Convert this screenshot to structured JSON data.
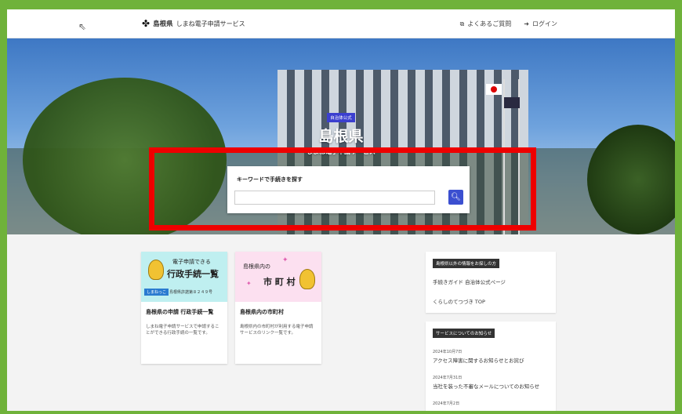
{
  "header": {
    "logo_prefix": "島根県",
    "logo_suffix": "しまね電子申請サービス",
    "faq_label": "よくあるご質問",
    "login_label": "ログイン"
  },
  "hero": {
    "badge": "自治体公式",
    "title": "島根県",
    "subtitle": "しまね電子申請サービス"
  },
  "search": {
    "label": "キーワードで手続きを探す",
    "value": "",
    "placeholder": ""
  },
  "cards": [
    {
      "image_line1": "電子申請できる",
      "image_line2": "行政手続一覧",
      "image_badge": "しまねっこ",
      "image_note": "島根県許諾第８２４９号",
      "title": "島根県の申請 行政手続一覧",
      "desc": "しまね電子申請サービスで申請することができる行政手続の一覧です。"
    },
    {
      "image_line1": "島根県内の",
      "image_line2": "市 町 村",
      "title": "島根県内の市町村",
      "desc": "島根県内の市町村が利用する電子申請サービスのリンク一覧です。"
    }
  ],
  "info_panel": {
    "heading": "島根県以外の情報をお探しの方",
    "links": [
      "手続きガイド 自治体公式ページ",
      "くらしのてつづき TOP"
    ]
  },
  "news_panel": {
    "heading": "サービスについてのお知らせ",
    "items": [
      {
        "date": "2024年10月7日",
        "title": "アクセス障害に関するお知らせとお詫び"
      },
      {
        "date": "2024年7月31日",
        "title": "当社を装った不審なメールについてのお知らせ"
      },
      {
        "date": "2024年7月2日",
        "title": ""
      }
    ]
  },
  "colors": {
    "frame": "#6fb23a",
    "highlight": "#ee0000",
    "accent": "#3b4fd0"
  }
}
